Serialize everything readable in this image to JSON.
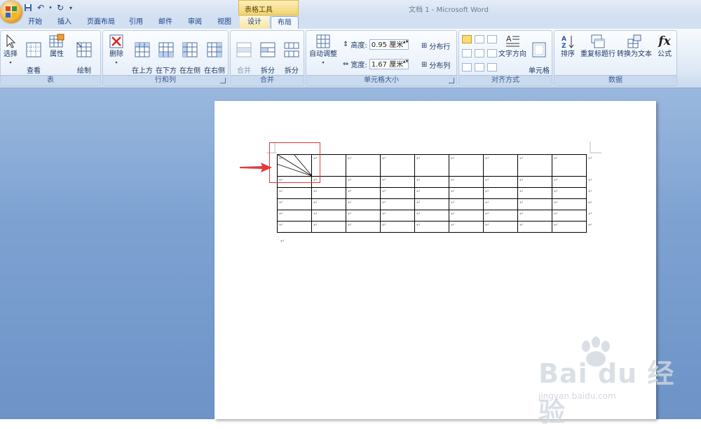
{
  "window": {
    "title": "文档 1 - Microsoft Word",
    "context_group": "表格工具"
  },
  "tabs": [
    {
      "label": "开始"
    },
    {
      "label": "插入"
    },
    {
      "label": "页面布局"
    },
    {
      "label": "引用"
    },
    {
      "label": "邮件"
    },
    {
      "label": "审阅"
    },
    {
      "label": "视图"
    },
    {
      "label": "设计"
    },
    {
      "label": "布局"
    }
  ],
  "ribbon": {
    "table": {
      "label": "表",
      "buttons": [
        {
          "label": "选择"
        },
        {
          "label": "查看\n网格线"
        },
        {
          "label": "属性"
        },
        {
          "label": "绘制\n斜线表头"
        }
      ]
    },
    "rows_cols": {
      "label": "行和列",
      "buttons": [
        {
          "label": "删除"
        },
        {
          "label": "在上方\n插入"
        },
        {
          "label": "在下方\n插入"
        },
        {
          "label": "在左侧\n插入"
        },
        {
          "label": "在右侧\n插入"
        }
      ]
    },
    "merge": {
      "label": "合并",
      "buttons": [
        {
          "label": "合并\n单元格"
        },
        {
          "label": "拆分\n单元格"
        },
        {
          "label": "拆分\n表格"
        }
      ]
    },
    "cell_size": {
      "label": "单元格大小",
      "autofit": "自动调整",
      "height_label": "高度:",
      "height_value": "0.95 厘米",
      "width_label": "宽度:",
      "width_value": "1.67 厘米",
      "distribute_rows": "分布行",
      "distribute_cols": "分布列"
    },
    "alignment": {
      "label": "对齐方式",
      "text_direction": "文字方向",
      "cell_margins": "单元格\n边距"
    },
    "data": {
      "label": "数据",
      "buttons": [
        {
          "label": "排序"
        },
        {
          "label": "重复标题行"
        },
        {
          "label": "转换为文本"
        },
        {
          "label": "公式"
        }
      ]
    }
  },
  "document": {
    "rows": 6,
    "cols": 9,
    "cell_mark": "↵"
  },
  "watermark": {
    "brand": "Bai du 经验",
    "url": "jingyan.baidu.com"
  },
  "colors": {
    "accent": "#15428b",
    "highlight": "#e23a3a",
    "workspace": "#7da2d2"
  }
}
